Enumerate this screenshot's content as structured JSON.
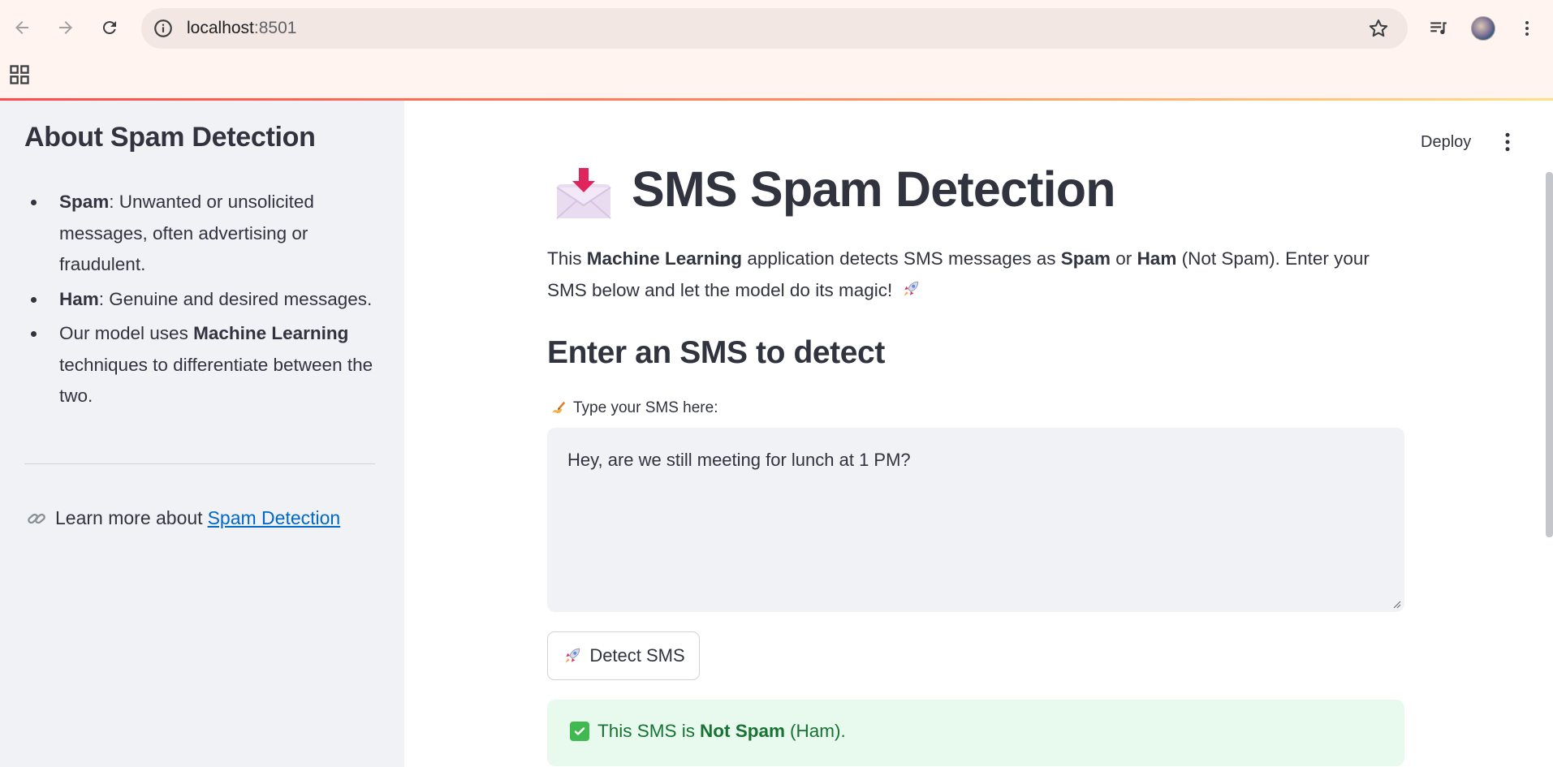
{
  "browser": {
    "url_host": "localhost",
    "url_port": ":8501"
  },
  "sidebar": {
    "title": "About Spam Detection",
    "items": [
      {
        "bold": "Spam",
        "text": ": Unwanted or unsolicited messages, often advertising or fraudulent."
      },
      {
        "bold": "Ham",
        "text": ": Genuine and desired messages."
      },
      {
        "pre": "Our model uses ",
        "bold": "Machine Learning",
        "text": " techniques to differentiate between the two."
      }
    ],
    "learn_prefix": "Learn more about",
    "learn_link": "Spam Detection"
  },
  "header": {
    "deploy_label": "Deploy"
  },
  "main": {
    "title": "SMS Spam Detection",
    "intro": {
      "t1": "This ",
      "b1": "Machine Learning",
      "t2": " application detects SMS messages as ",
      "b2": "Spam",
      "t3": " or ",
      "b3": "Ham",
      "t4": " (Not Spam). Enter your SMS below and let the model do its magic!"
    },
    "subheading": "Enter an SMS to detect",
    "input_label": "Type your SMS here:",
    "input_value": "Hey, are we still meeting for lunch at 1 PM?",
    "button_label": "Detect SMS",
    "result": {
      "prefix": "This SMS is",
      "verdict": "Not Spam",
      "suffix": "(Ham)."
    }
  },
  "colors": {
    "accent": "#ff4b4b",
    "link": "#0068c9",
    "success_bg": "#e8f9ee",
    "success_text": "#177233"
  }
}
